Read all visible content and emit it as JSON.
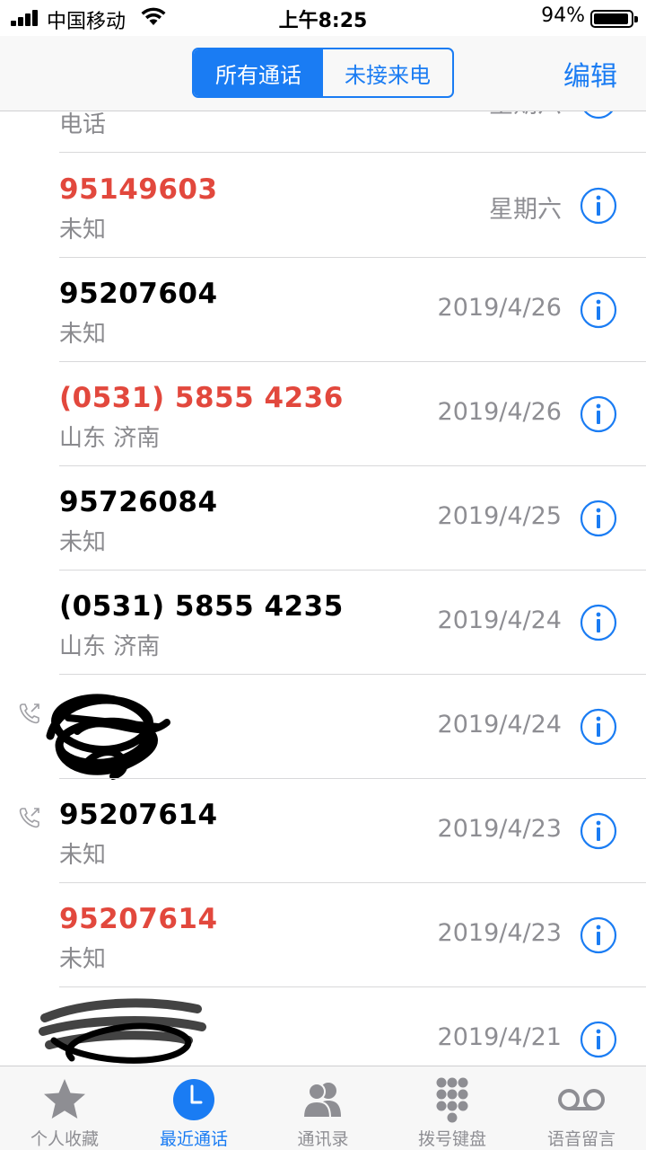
{
  "status_bar": {
    "carrier": "中国移动",
    "time": "上午8:25",
    "battery": "94%"
  },
  "nav": {
    "segments": [
      "所有通话",
      "未接来电"
    ],
    "selected_segment": "所有通话",
    "edit_label": "编辑"
  },
  "calls": [
    {
      "number": "",
      "label": "电话",
      "date": "星期六",
      "missed": false,
      "outgoing": false
    },
    {
      "number": "95149603",
      "label": "未知",
      "date": "星期六",
      "missed": true,
      "outgoing": false
    },
    {
      "number": "95207604",
      "label": "未知",
      "date": "2019/4/26",
      "missed": false,
      "outgoing": false
    },
    {
      "number": "(0531) 5855 4236",
      "label": "山东 济南",
      "date": "2019/4/26",
      "missed": true,
      "outgoing": false
    },
    {
      "number": "95726084",
      "label": "未知",
      "date": "2019/4/25",
      "missed": false,
      "outgoing": false
    },
    {
      "number": "(0531) 5855 4235",
      "label": "山东 济南",
      "date": "2019/4/24",
      "missed": false,
      "outgoing": false
    },
    {
      "number": "",
      "label": "",
      "date": "2019/4/24",
      "missed": false,
      "outgoing": true,
      "redacted": true
    },
    {
      "number": "95207614",
      "label": "未知",
      "date": "2019/4/23",
      "missed": false,
      "outgoing": true
    },
    {
      "number": "95207614",
      "label": "未知",
      "date": "2019/4/23",
      "missed": true,
      "outgoing": false
    },
    {
      "number": "",
      "label": "",
      "date": "2019/4/21",
      "missed": false,
      "outgoing": false,
      "redacted": true
    }
  ],
  "tabs": [
    {
      "label": "个人收藏",
      "icon": "star-icon"
    },
    {
      "label": "最近通话",
      "icon": "clock-icon",
      "active": true
    },
    {
      "label": "通讯录",
      "icon": "contacts-icon"
    },
    {
      "label": "拨号键盘",
      "icon": "keypad-icon"
    },
    {
      "label": "语音留言",
      "icon": "voicemail-icon"
    }
  ],
  "colors": {
    "accent": "#1a7cf3",
    "missed": "#e2483d",
    "secondary_text": "#8e8e93"
  }
}
